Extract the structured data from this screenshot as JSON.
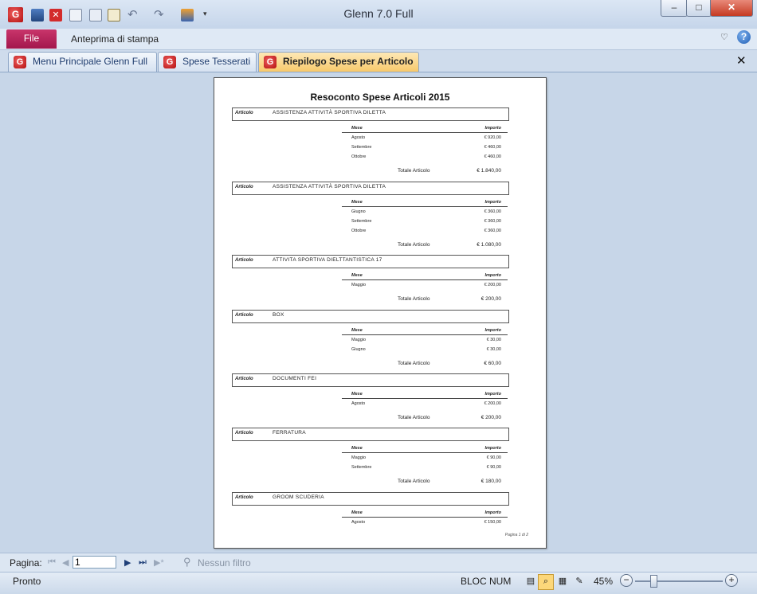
{
  "window": {
    "title": "Glenn 7.0 Full",
    "minimize": "–",
    "maximize": "□",
    "close": "✕"
  },
  "ribbon": {
    "file_label": "File",
    "active_tab": "Anteprima di stampa"
  },
  "tabs": [
    {
      "label": "Menu Principale Glenn Full",
      "active": false
    },
    {
      "label": "Spese Tesserati",
      "active": false
    },
    {
      "label": "Riepilogo Spese per Articolo",
      "active": true
    }
  ],
  "report": {
    "title": "Resoconto Spese Articoli 2015",
    "articolo_label": "Articolo",
    "mese_header": "Mese",
    "importo_header": "Importo",
    "totale_label": "Totale Articolo",
    "footer": "Pagina 1 di 2",
    "groups": [
      {
        "name": "ASSISTENZA ATTIVITÀ SPORTIVA DILETTA",
        "rows": [
          [
            "Agosto",
            "€ 920,00"
          ],
          [
            "Settembre",
            "€ 460,00"
          ],
          [
            "Ottobre",
            "€ 460,00"
          ]
        ],
        "total": "€ 1.840,00"
      },
      {
        "name": "ASSISTENZA ATTIVITÀ SPORTIVA DILETTA",
        "rows": [
          [
            "Giugno",
            "€ 360,00"
          ],
          [
            "Settembre",
            "€ 360,00"
          ],
          [
            "Ottobre",
            "€ 360,00"
          ]
        ],
        "total": "€ 1.080,00"
      },
      {
        "name": "ATTIVITA SPORTIVA DIELTTANTISTICA 17",
        "rows": [
          [
            "Maggio",
            "€ 200,00"
          ]
        ],
        "total": "€ 200,00"
      },
      {
        "name": "BOX",
        "rows": [
          [
            "Maggio",
            "€ 30,00"
          ],
          [
            "Giugno",
            "€ 30,00"
          ]
        ],
        "total": "€ 60,00"
      },
      {
        "name": "DOCUMENTI FEI",
        "rows": [
          [
            "Agosto",
            "€ 200,00"
          ]
        ],
        "total": "€ 200,00"
      },
      {
        "name": "FERRATURA",
        "rows": [
          [
            "Maggio",
            "€ 90,00"
          ],
          [
            "Settembre",
            "€ 90,00"
          ]
        ],
        "total": "€ 180,00"
      },
      {
        "name": "GROOM SCUDERIA",
        "rows": [
          [
            "Agosto",
            "€ 150,00"
          ]
        ],
        "total": null
      }
    ]
  },
  "navigation": {
    "page_label": "Pagina:",
    "page_value": "1",
    "filter_label": "Nessun filtro"
  },
  "status": {
    "ready": "Pronto",
    "num_lock": "BLOC NUM",
    "zoom": "45%"
  },
  "colors": {
    "file_tab": "#a3164c",
    "active_tab": "#f8c96b",
    "background": "#c7d6e8"
  }
}
